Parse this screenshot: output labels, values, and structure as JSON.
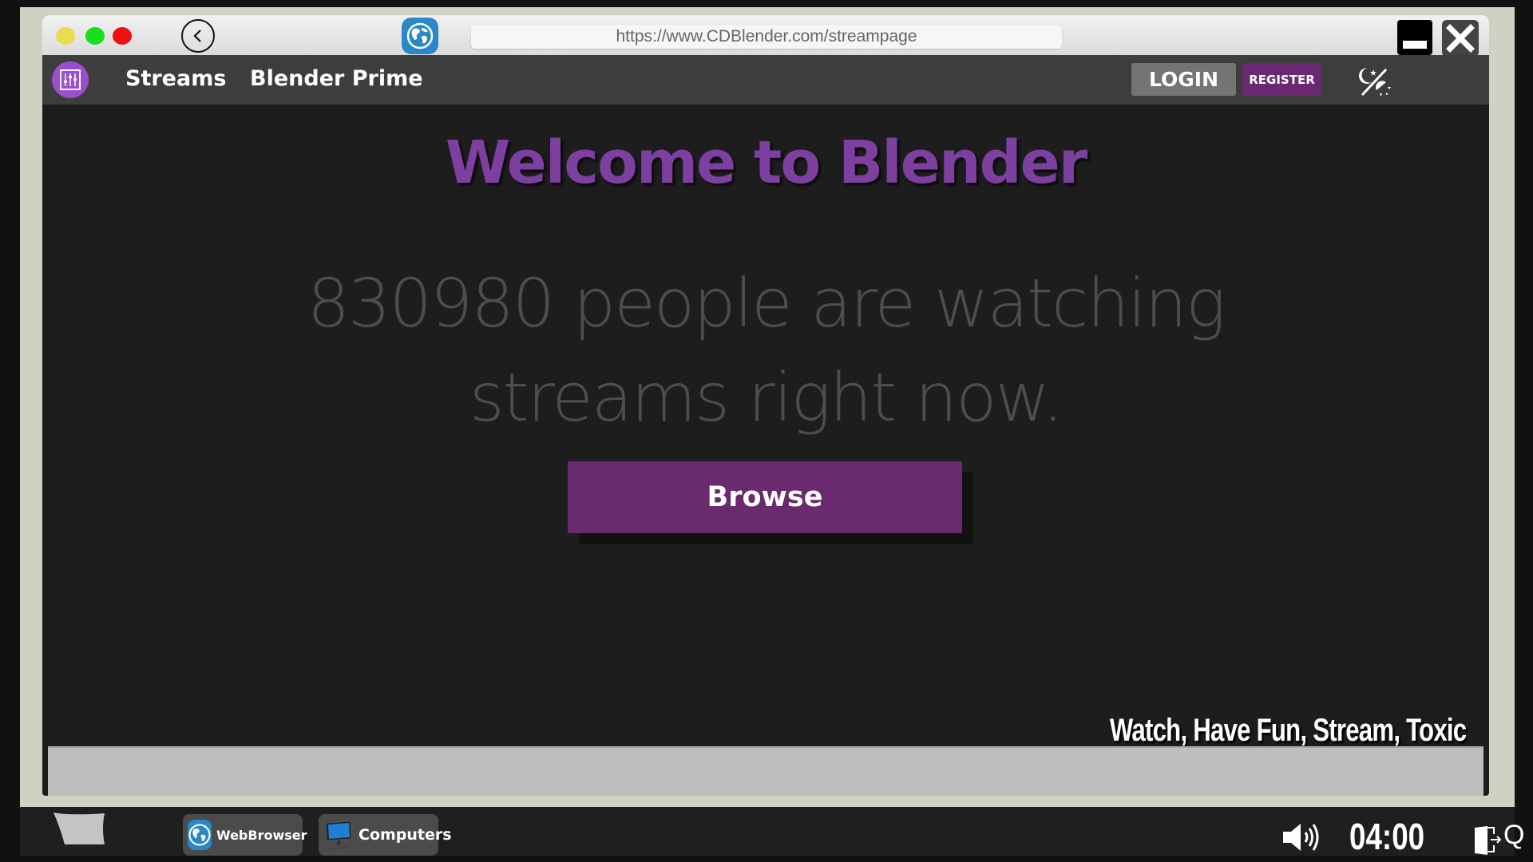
{
  "window": {
    "url": "https://www.CDBlender.com/streampage",
    "controls": {
      "minimize": "minimize",
      "close": "close"
    }
  },
  "navbar": {
    "links": [
      {
        "label": "Streams"
      },
      {
        "label": "Blender Prime"
      }
    ],
    "login_label": "LOGIN",
    "register_label": "REGISTER"
  },
  "main": {
    "title": "Welcome to Blender",
    "watching_line1": "830980 people are watching",
    "watching_line2": "streams right now.",
    "viewer_count": 830980,
    "browse_label": "Browse",
    "slogan": "Watch, Have Fun, Stream, Toxic"
  },
  "taskbar": {
    "items": [
      {
        "label": "WebBrowser",
        "icon": "globe-icon"
      },
      {
        "label": "Computers",
        "icon": "monitor-icon"
      }
    ],
    "clock": "04:00",
    "trailing_glyph": "Q"
  },
  "colors": {
    "accent_purple": "#692b6d",
    "title_purple": "#7d3fa0",
    "logo_purple": "#9b4ed0",
    "frame": "#d0d1c3",
    "navbar": "#3d3d3d",
    "content_bg": "#1d1d1d"
  }
}
